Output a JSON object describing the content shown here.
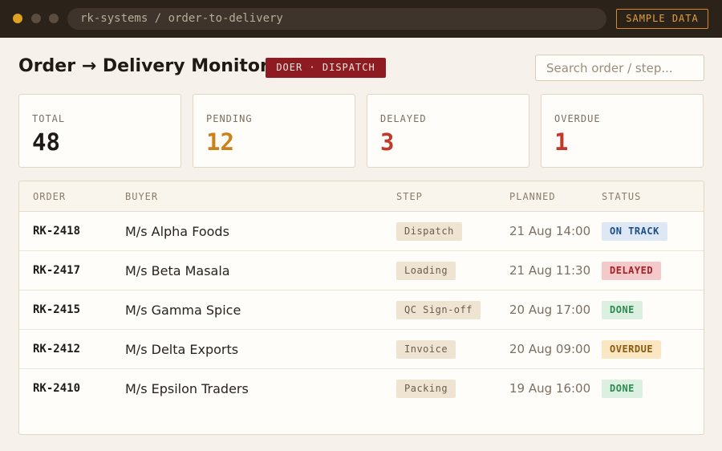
{
  "window": {
    "address": "rk-systems / order-to-delivery",
    "sample_label": "SAMPLE DATA"
  },
  "header": {
    "title": "Order → Delivery Monitor",
    "role_badge": "DOER · DISPATCH",
    "search_placeholder": "Search order / step..."
  },
  "stats": [
    {
      "label": "TOTAL",
      "value": "48",
      "color": "#1f1a15"
    },
    {
      "label": "PENDING",
      "value": "12",
      "color": "#c9831a"
    },
    {
      "label": "DELAYED",
      "value": "3",
      "color": "#c0392b"
    },
    {
      "label": "OVERDUE",
      "value": "1",
      "color": "#c0392b"
    }
  ],
  "table": {
    "columns": [
      "ORDER",
      "BUYER",
      "STEP",
      "PLANNED",
      "STATUS"
    ],
    "rows": [
      {
        "order": "RK-2418",
        "buyer": "M/s Alpha Foods",
        "step": "Dispatch",
        "planned": "21 Aug 14:00",
        "status": "ON TRACK"
      },
      {
        "order": "RK-2417",
        "buyer": "M/s Beta Masala",
        "step": "Loading",
        "planned": "21 Aug 11:30",
        "status": "DELAYED"
      },
      {
        "order": "RK-2415",
        "buyer": "M/s Gamma Spice",
        "step": "QC Sign-off",
        "planned": "20 Aug 17:00",
        "status": "DONE"
      },
      {
        "order": "RK-2412",
        "buyer": "M/s Delta Exports",
        "step": "Invoice",
        "planned": "20 Aug 09:00",
        "status": "OVERDUE"
      },
      {
        "order": "RK-2410",
        "buyer": "M/s Epsilon Traders",
        "step": "Packing",
        "planned": "19 Aug 16:00",
        "status": "DONE"
      }
    ]
  },
  "status_colors": {
    "ON TRACK": {
      "bg": "#dde8f4",
      "fg": "#1f4e86"
    },
    "DELAYED": {
      "bg": "#f3c9c9",
      "fg": "#a32026"
    },
    "DONE": {
      "bg": "#dcf0e2",
      "fg": "#2c8a4e"
    },
    "OVERDUE": {
      "bg": "#fbe6c2",
      "fg": "#8a5a0c"
    }
  }
}
